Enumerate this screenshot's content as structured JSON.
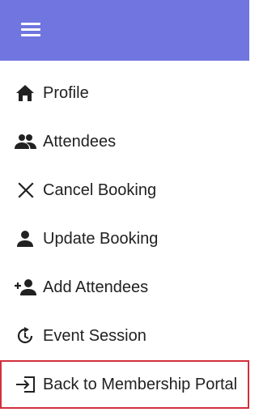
{
  "header": {
    "menu_icon": "hamburger-menu-icon",
    "background_color": "#7075e0"
  },
  "menu": {
    "items": [
      {
        "label": "Profile",
        "icon": "home-icon"
      },
      {
        "label": "Attendees",
        "icon": "people-icon"
      },
      {
        "label": "Cancel Booking",
        "icon": "close-icon"
      },
      {
        "label": "Update Booking",
        "icon": "person-icon"
      },
      {
        "label": "Add Attendees",
        "icon": "person-add-icon"
      },
      {
        "label": "Event Session",
        "icon": "history-icon"
      },
      {
        "label": "Back to Membership Portal",
        "icon": "login-icon",
        "highlighted": true
      }
    ]
  },
  "colors": {
    "text": "#212121",
    "highlight_border": "#d32f3c"
  }
}
